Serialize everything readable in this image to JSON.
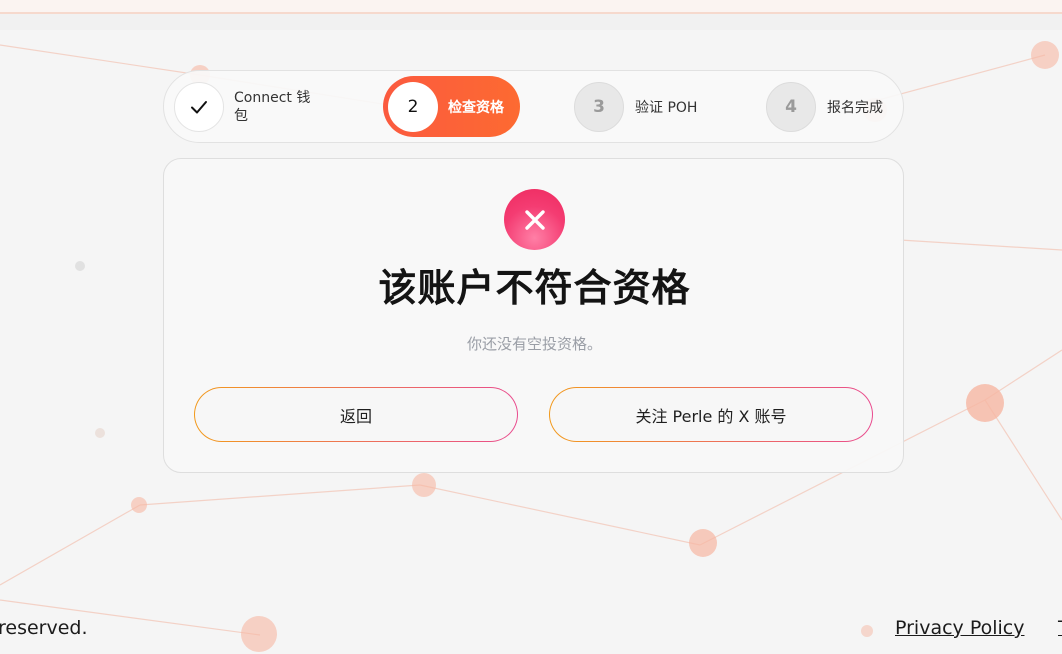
{
  "stepper": {
    "steps": [
      {
        "number": "",
        "label": "Connect 钱包",
        "state": "done",
        "icon": "check-icon"
      },
      {
        "number": "2",
        "label": "检查资格",
        "state": "active"
      },
      {
        "number": "3",
        "label": "验证 POH",
        "state": "pending"
      },
      {
        "number": "4",
        "label": "报名完成",
        "state": "pending"
      }
    ]
  },
  "card": {
    "icon": "close-icon",
    "title": "该账户不符合资格",
    "subtitle": "你还没有空投资格。",
    "back_label": "返回",
    "follow_label": "关注 Perle 的 X 账号"
  },
  "footer": {
    "rights_text": "reserved.",
    "privacy_label": "Privacy Policy",
    "terms_label": "T"
  },
  "colors": {
    "active_step": "#fb5a3f",
    "error_badge": "#f43c72",
    "button_border_start": "#f29a1c",
    "button_border_end": "#e94c8f"
  }
}
